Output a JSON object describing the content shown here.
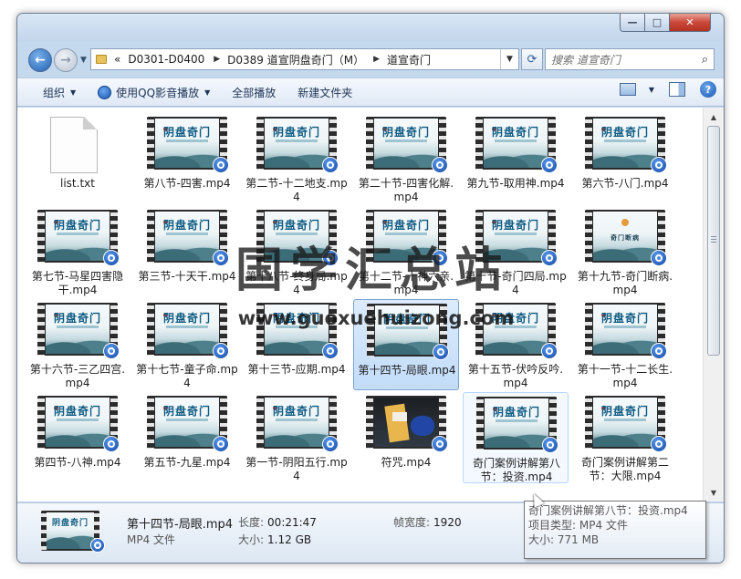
{
  "window": {
    "caption_min": "—",
    "caption_max": "□",
    "caption_close": "✕"
  },
  "nav": {
    "back_glyph": "←",
    "forward_glyph": "→",
    "breadcrumb_prefix": "«",
    "breadcrumbs": [
      "D0301-D0400",
      "D0389 道宣阴盘奇门（M）",
      "道宣奇门"
    ],
    "search_placeholder": "搜索 道宣奇门"
  },
  "toolbar": {
    "organize": "组织",
    "play_with_qq": "使用QQ影音播放",
    "play_all": "全部播放",
    "new_folder": "新建文件夹",
    "help": "?"
  },
  "thumb_text": {
    "yinpan": "阴盘奇门",
    "duanbing": "奇门断病"
  },
  "files": [
    {
      "label": "list.txt",
      "kind": "txt"
    },
    {
      "label": "第八节-四害.mp4",
      "kind": "video"
    },
    {
      "label": "第二节-十二地支.mp4",
      "kind": "video"
    },
    {
      "label": "第二十节-四害化解.mp4",
      "kind": "video"
    },
    {
      "label": "第九节-取用神.mp4",
      "kind": "video"
    },
    {
      "label": "第六节-八门.mp4",
      "kind": "video"
    },
    {
      "label": "第七节-马星四害隐干.mp4",
      "kind": "video"
    },
    {
      "label": "第三节-十天干.mp4",
      "kind": "video"
    },
    {
      "label": "第十八节-终身局.mp4",
      "kind": "video"
    },
    {
      "label": "第十二节-十神六亲.mp4",
      "kind": "video"
    },
    {
      "label": "第十节-奇门四局.mp4",
      "kind": "video"
    },
    {
      "label": "第十九节-奇门断病.mp4",
      "kind": "video-alt"
    },
    {
      "label": "第十六节-三乙四宫.mp4",
      "kind": "video"
    },
    {
      "label": "第十七节-童子命.mp4",
      "kind": "video"
    },
    {
      "label": "第十三节-应期.mp4",
      "kind": "video"
    },
    {
      "label": "第十四节-局眼.mp4",
      "kind": "video",
      "selected": true
    },
    {
      "label": "第十五节-伏吟反吟.mp4",
      "kind": "video"
    },
    {
      "label": "第十一节-十二长生.mp4",
      "kind": "video"
    },
    {
      "label": "第四节-八神.mp4",
      "kind": "video"
    },
    {
      "label": "第五节-九星.mp4",
      "kind": "video"
    },
    {
      "label": "第一节-阴阳五行.mp4",
      "kind": "video"
    },
    {
      "label": "符咒.mp4",
      "kind": "video-photo"
    },
    {
      "label": "奇门案例讲解第八节：投资.mp4",
      "kind": "video",
      "hover": true
    },
    {
      "label": "奇门案例讲解第二节：大限.mp4",
      "kind": "video"
    }
  ],
  "details": {
    "name": "第十四节-局眼.mp4",
    "type": "MP4 文件",
    "length_label": "长度:",
    "length_value": "00:21:47",
    "size_label": "大小:",
    "size_value": "1.12 GB",
    "width_label": "帧宽度:",
    "width_value": "1920"
  },
  "tooltip": {
    "line1": "奇门案例讲解第八节：投资.mp4",
    "line2": "项目类型: MP4 文件",
    "line3": "大小: 771 MB"
  },
  "watermark": {
    "text": "国学汇总站",
    "url": "www.guoxuehuizong.com"
  }
}
